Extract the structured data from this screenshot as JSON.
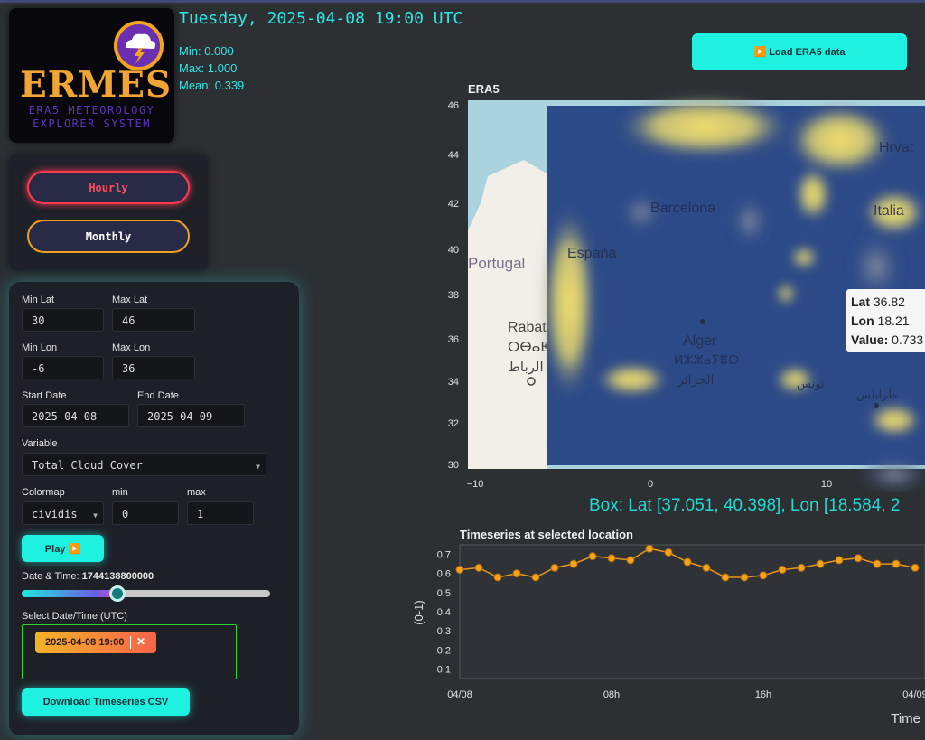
{
  "header": {
    "datetime": "Tuesday, 2025-04-08 19:00 UTC",
    "stats": {
      "min": "Min: 0.000",
      "max": "Max: 1.000",
      "mean": "Mean: 0.339"
    },
    "load_button": "▶️ Load ERA5 data"
  },
  "logo": {
    "word": "ERMES",
    "line1": "ERA5 METEOROLOGY",
    "line2": "EXPLORER SYSTEM"
  },
  "mode": {
    "hourly": "Hourly",
    "monthly": "Monthly"
  },
  "controls": {
    "min_lat_label": "Min Lat",
    "min_lat": "30",
    "max_lat_label": "Max Lat",
    "max_lat": "46",
    "min_lon_label": "Min Lon",
    "min_lon": "-6",
    "max_lon_label": "Max Lon",
    "max_lon": "36",
    "start_label": "Start Date",
    "start": "2025-04-08",
    "end_label": "End Date",
    "end": "2025-04-09",
    "variable_label": "Variable",
    "variable": "Total Cloud Cover",
    "colormap_label": "Colormap",
    "colormap": "cividis",
    "cmin_label": "min",
    "cmin": "0",
    "cmax_label": "max",
    "cmax": "1",
    "play": "Play ▶️",
    "datetime_label": "Date & Time:",
    "datetime_value": "1744138800000",
    "slider_fraction": 0.39,
    "select_label": "Select Date/Time (UTC)",
    "chip": "2025-04-08 19:00",
    "chip_close": "✕",
    "download": "Download Timeseries CSV"
  },
  "map": {
    "title": "ERA5",
    "yticks": [
      "46",
      "44",
      "42",
      "40",
      "38",
      "36",
      "34",
      "32",
      "30"
    ],
    "xticks": [
      "−10",
      "0",
      "10"
    ],
    "places": [
      "Portugal",
      "España",
      "Barcelona",
      "Rabat",
      "ⵔⴱⴰⵟ",
      "الرباط",
      "Alger",
      "ⵍⵣⵣⴰⵢⴻⵔ",
      "الجزائر",
      "Hrvat",
      "Italia",
      "طرابلس",
      "تونس"
    ],
    "tooltip": {
      "lat_label": "Lat",
      "lat": "36.82",
      "lon_label": "Lon",
      "lon": "18.21",
      "value_label": "Value:",
      "value": "0.733"
    },
    "box_text": "Box: Lat [37.051, 40.398], Lon [18.584, 2"
  },
  "colors": {
    "accent": "#1ff1e0",
    "hourly": "#ff3a50",
    "monthly": "#f0a020",
    "series": "#f5a31a"
  },
  "chart_data": {
    "type": "line",
    "title": "Timeseries at selected location",
    "xlabel": "Time",
    "ylabel": "(0-1)",
    "xtick_labels": [
      "04/08",
      "08h",
      "16h",
      "04/09"
    ],
    "yticks": [
      "0.7",
      "0.6",
      "0.5",
      "0.4",
      "0.3",
      "0.2",
      "0.1"
    ],
    "ylim": [
      0.05,
      0.75
    ],
    "x": [
      0,
      1,
      2,
      3,
      4,
      5,
      6,
      7,
      8,
      9,
      10,
      11,
      12,
      13,
      14,
      15,
      16,
      17,
      18,
      19,
      20,
      21,
      22,
      23,
      24,
      25
    ],
    "x_unit": "hours since 2025-04-08 00:00",
    "series": [
      {
        "values": [
          0.62,
          0.63,
          0.58,
          0.6,
          0.58,
          0.63,
          0.65,
          0.69,
          0.68,
          0.67,
          0.73,
          0.71,
          0.66,
          0.63,
          0.58,
          0.58,
          0.59,
          0.62,
          0.63,
          0.65,
          0.67,
          0.68,
          0.65,
          0.65,
          0.63,
          0.63
        ]
      }
    ]
  }
}
